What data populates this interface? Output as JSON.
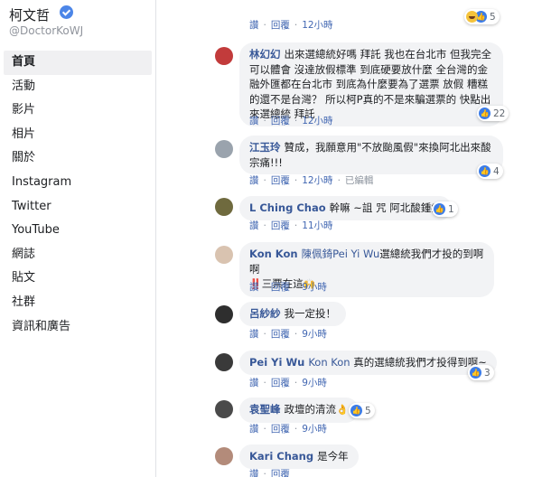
{
  "sidebar": {
    "page_name": "柯文哲",
    "handle": "@DoctorKoWJ",
    "items": [
      {
        "label": "首頁",
        "active": true
      },
      {
        "label": "活動"
      },
      {
        "label": "影片"
      },
      {
        "label": "相片"
      },
      {
        "label": "關於"
      },
      {
        "label": "Instagram"
      },
      {
        "label": "Twitter"
      },
      {
        "label": "YouTube"
      },
      {
        "label": "網誌"
      },
      {
        "label": "貼文"
      },
      {
        "label": "社群"
      },
      {
        "label": "資訊和廣告"
      }
    ]
  },
  "actions": {
    "like": "讚",
    "reply": "回覆",
    "sep": "·"
  },
  "comments": [
    {
      "author": "",
      "text": "",
      "time": "12小時",
      "reaction_count": "5",
      "reaction_icons": [
        "haha-icon",
        "like-icon"
      ],
      "avatar_color": "#8a9bb2"
    },
    {
      "author": "林幻幻",
      "text": "出來選總統好嗎 拜託 我也在台北市 但我完全可以體會 沒達放假標準 到底硬要放什麼 全台灣的金融外匯都在台北市 到底為什麼要為了選票 放假 糟糕的還不是台灣？ 所以柯P真的不是來騙選票的 快點出來選總統 拜託",
      "time": "12小時",
      "reaction_count": "22",
      "avatar_color": "#c23b3b"
    },
    {
      "author": "江玉玲",
      "text": "贊成，我願意用\"不放颱風假\"來換阿北出來酸宗痛!!!",
      "time": "12小時",
      "edited": "已編輯",
      "reaction_count": "4",
      "avatar_color": "#9aa3ad"
    },
    {
      "author": "L Ching Chao",
      "text": "幹嘛 ~詛 咒 阿北酸鍾痛",
      "time": "11小時",
      "reaction_count": "1",
      "avatar_color": "#6f6a3e"
    },
    {
      "author": "Kon Kon",
      "tag": "陳佩錡Pei Yi Wu",
      "text": "選總統我們才投的到啊啊",
      "text2_emoji": "‼️",
      "text2": "三票在這",
      "text2_tail": "🙌",
      "time": "9小時",
      "avatar_color": "#d9c3b0"
    },
    {
      "author": "呂紗紗",
      "text": "我一定投！",
      "time": "9小時",
      "avatar_color": "#2e2e2e"
    },
    {
      "author": "Pei Yi Wu",
      "tag": "Kon Kon",
      "text": "真的選總統我們才投得到啊~",
      "time": "9小時",
      "reaction_count": "3",
      "avatar_color": "#3a3a3a"
    },
    {
      "author": "袁聖峰",
      "text": "政壇的清流",
      "emoji": "👌",
      "time": "9小時",
      "reaction_count": "5",
      "avatar_color": "#4a4a4a"
    },
    {
      "author": "Kari Chang",
      "text": "是今年",
      "time": "",
      "avatar_color": "#b38b7a"
    }
  ]
}
